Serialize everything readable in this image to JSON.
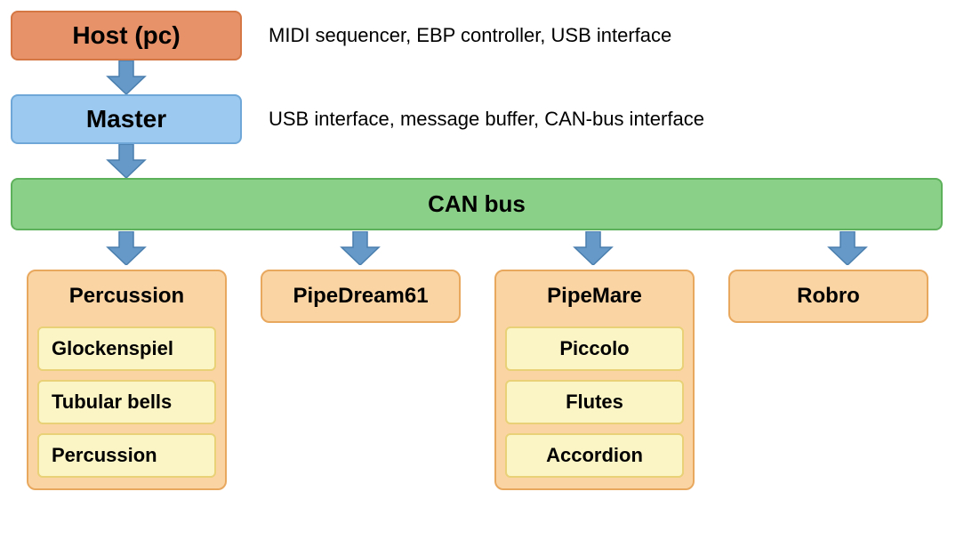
{
  "host": {
    "label": "Host (pc)",
    "desc": "MIDI sequencer, EBP controller, USB interface"
  },
  "master": {
    "label": "Master",
    "desc": "USB interface, message buffer, CAN-bus interface"
  },
  "canbus": {
    "label": "CAN bus"
  },
  "devices": {
    "percussion": {
      "title": "Percussion",
      "subs": {
        "a": "Glockenspiel",
        "b": "Tubular bells",
        "c": "Percussion"
      }
    },
    "pipedream61": {
      "title": "PipeDream61"
    },
    "pipemare": {
      "title": "PipeMare",
      "subs": {
        "a": "Piccolo",
        "b": "Flutes",
        "c": "Accordion"
      }
    },
    "robro": {
      "title": "Robro"
    }
  },
  "colors": {
    "arrow_fill": "#6699c7",
    "arrow_stroke": "#4a7fae"
  }
}
